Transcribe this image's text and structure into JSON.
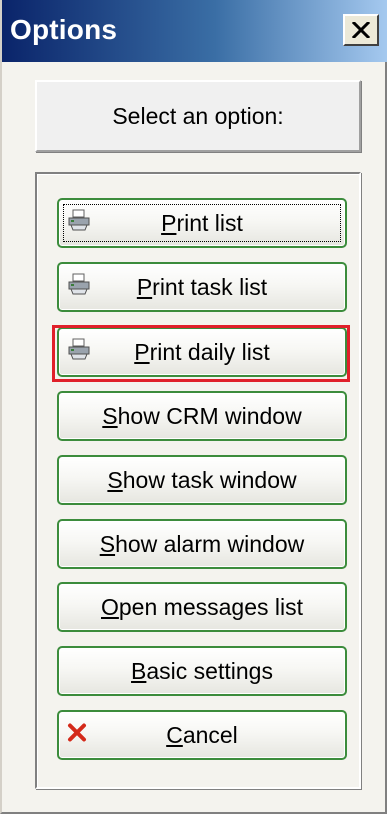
{
  "window": {
    "title": "Options"
  },
  "header": {
    "prompt": "Select an option:"
  },
  "buttons": [
    {
      "label_pre": "",
      "label_mnemonic": "P",
      "label_post": "rint list",
      "icon": "printer-icon"
    },
    {
      "label_pre": "",
      "label_mnemonic": "P",
      "label_post": "rint task list",
      "icon": "printer-icon"
    },
    {
      "label_pre": "",
      "label_mnemonic": "P",
      "label_post": "rint daily list",
      "icon": "printer-icon"
    },
    {
      "label_pre": "",
      "label_mnemonic": "S",
      "label_post": "how CRM window",
      "icon": ""
    },
    {
      "label_pre": "",
      "label_mnemonic": "S",
      "label_post": "how task window",
      "icon": ""
    },
    {
      "label_pre": "",
      "label_mnemonic": "S",
      "label_post": "how alarm window",
      "icon": ""
    },
    {
      "label_pre": "",
      "label_mnemonic": "O",
      "label_post": "pen messages list",
      "icon": ""
    },
    {
      "label_pre": "",
      "label_mnemonic": "B",
      "label_post": "asic settings",
      "icon": ""
    },
    {
      "label_pre": "",
      "label_mnemonic": "C",
      "label_post": "ancel",
      "icon": "cancel-x-icon"
    }
  ],
  "colors": {
    "highlight_border": "#e0202a",
    "button_border": "#3c8c3c",
    "titlebar_start": "#0a246a"
  }
}
